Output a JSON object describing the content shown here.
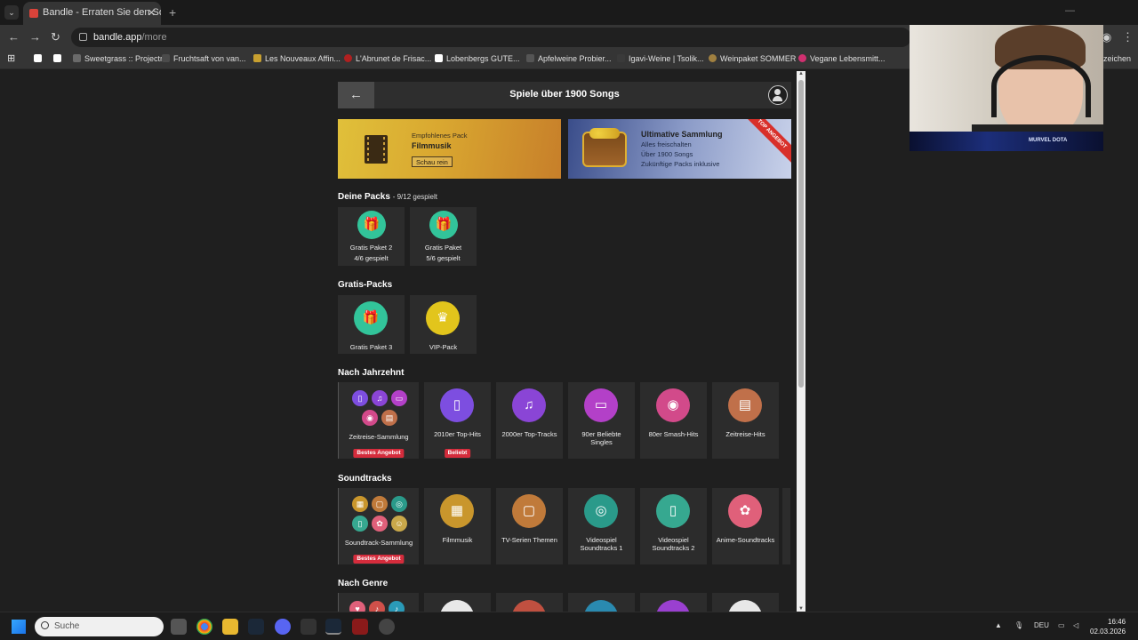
{
  "browser": {
    "tab_title": "Bandle - Erraten Sie den Song, ...",
    "url_host": "bandle.app",
    "url_path": "/more",
    "bookmarks": [
      {
        "label": "Sweetgrass :: Projectr",
        "color": "#6a6a6a"
      },
      {
        "label": "Fruchtsaft von van...",
        "color": "#4b4b4b"
      },
      {
        "label": "Les Nouveaux Affin...",
        "color": "#c8a030"
      },
      {
        "label": "L'Abrunet de Frisac...",
        "color": "#b02020"
      },
      {
        "label": "Lobenbergs GUTE...",
        "color": "#ffffff"
      },
      {
        "label": "Apfelweine Probier...",
        "color": "#555555"
      },
      {
        "label": "Igavi-Weine | Tsolik...",
        "color": "#3a3a3a"
      },
      {
        "label": "Weinpaket SOMMER",
        "color": "#a08040"
      },
      {
        "label": "Vegane Lebensmitt...",
        "color": "#d03070"
      }
    ],
    "bookmarks_end": "zeichen"
  },
  "header": {
    "back_icon": "arrow-left-icon",
    "title": "Spiele über 1900 Songs"
  },
  "banners": {
    "featured": {
      "kicker": "Empfohlenes Pack",
      "name": "Filmmusik",
      "button": "Schau rein"
    },
    "ultimate": {
      "title": "Ultimative Sammlung",
      "line1": "Alles freischalten",
      "line2": "Über 1900 Songs",
      "line3": "Zukünftige Packs inklusive",
      "ribbon": "TOP ANGEBOT"
    }
  },
  "your_packs": {
    "title": "Deine Packs",
    "progress": "- 9/12 gespielt",
    "items": [
      {
        "name": "Gratis Paket 2",
        "status": "4/6 gespielt"
      },
      {
        "name": "Gratis Paket",
        "status": "5/6 gespielt"
      }
    ]
  },
  "free_packs": {
    "title": "Gratis-Packs",
    "items": [
      {
        "name": "Gratis Paket 3",
        "icon": "gift-icon"
      },
      {
        "name": "VIP-Pack",
        "icon": "crown-icon"
      }
    ]
  },
  "decades": {
    "title": "Nach Jahrzehnt",
    "items": [
      {
        "name": "Zeitreise-Sammlung",
        "badge": "Bestes Angebot"
      },
      {
        "name": "2010er Top-Hits",
        "badge": "Beliebt",
        "color": "#7d4ee0"
      },
      {
        "name": "2000er Top-Tracks",
        "color": "#8a45d6"
      },
      {
        "name": "90er Beliebte",
        "name2": "Singles",
        "color": "#b340c8"
      },
      {
        "name": "80er Smash-Hits",
        "color": "#d24a8a"
      },
      {
        "name": "Zeitreise-Hits",
        "color": "#c0704a"
      }
    ]
  },
  "soundtracks": {
    "title": "Soundtracks",
    "items": [
      {
        "name": "Soundtrack-Sammlung",
        "badge": "Bestes Angebot"
      },
      {
        "name": "Filmmusik",
        "color": "#c9962c"
      },
      {
        "name": "TV-Serien Themen",
        "color": "#c07a3a"
      },
      {
        "name": "Videospiel",
        "name2": "Soundtracks 1",
        "color": "#2a9a8a"
      },
      {
        "name": "Videospiel",
        "name2": "Soundtracks 2",
        "color": "#36a890"
      },
      {
        "name": "Anime-Soundtracks",
        "color": "#e0607a"
      }
    ]
  },
  "genre": {
    "title": "Nach Genre"
  },
  "webcam": {
    "overlay": "MURVEL DOTA"
  },
  "taskbar": {
    "search_placeholder": "Suche",
    "lang": "DEU",
    "time": "16:46",
    "date": "02.03.2026"
  }
}
